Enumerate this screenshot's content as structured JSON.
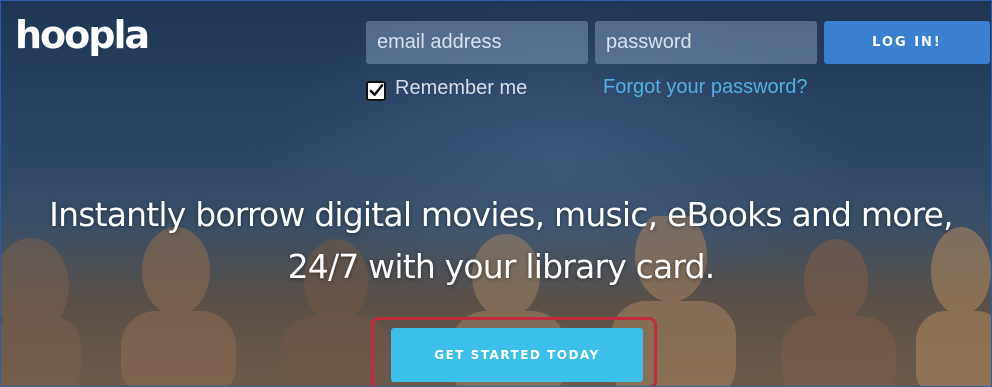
{
  "brand": {
    "logo_text": "hoopla"
  },
  "login": {
    "email_placeholder": "email address",
    "password_placeholder": "password",
    "login_label": "LOG IN!",
    "remember_label": "Remember me",
    "remember_checked": true,
    "forgot_label": "Forgot your password?"
  },
  "hero": {
    "line1": "Instantly borrow digital movies, music, eBooks and more,",
    "line2": "24/7 with your library card.",
    "cta_label": "GET STARTED TODAY"
  },
  "colors": {
    "accent": "#3b7fd0",
    "cta": "#3cbfe9",
    "link": "#4fb0e6",
    "highlight": "#c42a3e"
  },
  "icons": {
    "checkbox": "checkmark-icon"
  }
}
